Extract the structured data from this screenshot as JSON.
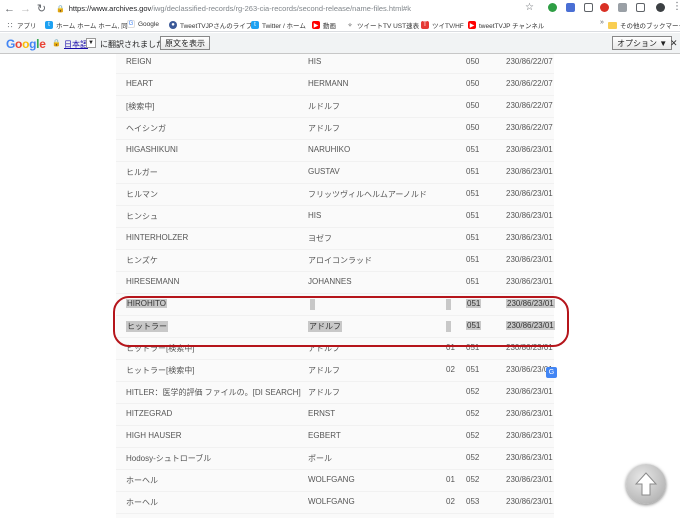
{
  "browser": {
    "url_host": "https://www.archives.gov",
    "url_path": "/iwg/declassified-records/rg-263-cia-records/second-release/name-files.html#k",
    "bookmarks": [
      {
        "label": "アプリ",
        "icon": "apps-grid-icon",
        "color": "#5f6368"
      },
      {
        "label": "ホーム ホーム ホーム, 同",
        "icon": "twitter-icon",
        "color": "#1da1f2"
      },
      {
        "label": "Google",
        "icon": "google-icon",
        "color": "#4285f4"
      },
      {
        "label": "TweetTVJPさんのライブ",
        "icon": "livestream-icon",
        "color": "#3b5998"
      },
      {
        "label": "Twitter / ホーム",
        "icon": "twitter-icon",
        "color": "#1da1f2"
      },
      {
        "label": "動画",
        "icon": "youtube-icon",
        "color": "#ff0000"
      },
      {
        "label": "ツイートTV UST速表",
        "icon": "ustream-icon",
        "color": "#333333"
      },
      {
        "label": "ツイTV/HF",
        "icon": "app-icon",
        "color": "#e53935"
      },
      {
        "label": "tweetTVJP チャンネル",
        "icon": "youtube-icon",
        "color": "#ff0000"
      }
    ],
    "other_bookmarks": "その他のブックマーク"
  },
  "translate_bar": {
    "logo": "Google",
    "language": "日本語",
    "message": "に翻訳されました",
    "show_original": "原文を表示",
    "options": "オプション ▼",
    "close": "✕"
  },
  "table": {
    "rows": [
      {
        "name": "REIGN",
        "given": "HIS",
        "num": "",
        "code": "050",
        "ref": "230/86/22/07"
      },
      {
        "name": "HEART",
        "given": "HERMANN",
        "num": "",
        "code": "050",
        "ref": "230/86/22/07"
      },
      {
        "name": "[検索中]",
        "given": "ルドルフ",
        "num": "",
        "code": "050",
        "ref": "230/86/22/07"
      },
      {
        "name": "ヘイシンガ",
        "given": "アドルフ",
        "num": "",
        "code": "050",
        "ref": "230/86/22/07"
      },
      {
        "name": "HIGASHIKUNI",
        "given": "NARUHIKO",
        "num": "",
        "code": "051",
        "ref": "230/86/23/01"
      },
      {
        "name": "ヒルガー",
        "given": "GUSTAV",
        "num": "",
        "code": "051",
        "ref": "230/86/23/01"
      },
      {
        "name": "ヒルマン",
        "given": "フリッツヴィルヘルムアーノルド",
        "num": "",
        "code": "051",
        "ref": "230/86/23/01"
      },
      {
        "name": "ヒンシュ",
        "given": "HIS",
        "num": "",
        "code": "051",
        "ref": "230/86/23/01"
      },
      {
        "name": "HINTERHOLZER",
        "given": "ヨゼフ",
        "num": "",
        "code": "051",
        "ref": "230/86/23/01"
      },
      {
        "name": "ヒンズケ",
        "given": "アロイコンラッド",
        "num": "",
        "code": "051",
        "ref": "230/86/23/01"
      },
      {
        "name": "HIRESEMANN",
        "given": "JOHANNES",
        "num": "",
        "code": "051",
        "ref": "230/86/23/01"
      },
      {
        "name": "HIROHITO",
        "given": "",
        "num": "",
        "code": "051",
        "ref": "230/86/23/01",
        "selected": true
      },
      {
        "name": "ヒットラー",
        "given": "アドルフ",
        "num": "",
        "code": "051",
        "ref": "230/86/23/01",
        "selected": true
      },
      {
        "name": "ヒットラー[検索中]",
        "given": "アドルフ",
        "num": "01",
        "code": "051",
        "ref": "230/86/23/01"
      },
      {
        "name": "ヒットラー[検索中]",
        "given": "アドルフ",
        "num": "02",
        "code": "051",
        "ref": "230/86/23/01"
      },
      {
        "name": "HITLER：医学的評価 ファイルの。[DI SEARCH]",
        "given": "アドルフ",
        "num": "",
        "code": "052",
        "ref": "230/86/23/01"
      },
      {
        "name": "HITZEGRAD",
        "given": "ERNST",
        "num": "",
        "code": "052",
        "ref": "230/86/23/01"
      },
      {
        "name": "HIGH HAUSER",
        "given": "EGBERT",
        "num": "",
        "code": "052",
        "ref": "230/86/23/01"
      },
      {
        "name": "Hodosy-シュトローブル",
        "given": "ポール",
        "num": "",
        "code": "052",
        "ref": "230/86/23/01"
      },
      {
        "name": "ホーヘル",
        "given": "WOLFGANG",
        "num": "01",
        "code": "052",
        "ref": "230/86/23/01"
      },
      {
        "name": "ホーヘル",
        "given": "WOLFGANG",
        "num": "02",
        "code": "053",
        "ref": "230/86/23/01"
      }
    ]
  },
  "colors": {
    "highlight_oval": "#b5151b",
    "selection": "#c8c8c8"
  },
  "icons": {
    "back": "arrow-left-icon",
    "forward": "arrow-right-icon",
    "reload": "reload-icon",
    "scroll_top": "arrow-up-icon",
    "translate": "google-translate-icon"
  }
}
